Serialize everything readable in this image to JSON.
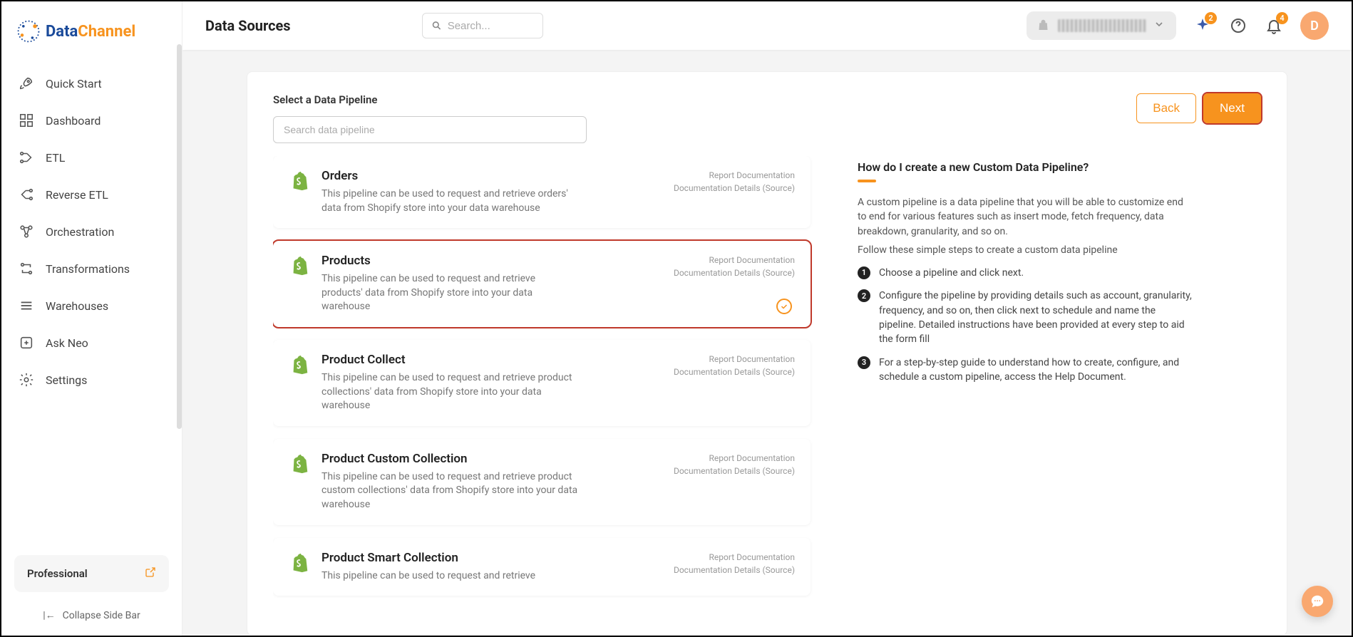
{
  "brand": {
    "name1": "Data",
    "name2": "Channel"
  },
  "sidebar": {
    "items": [
      {
        "label": "Quick Start",
        "icon": "rocket"
      },
      {
        "label": "Dashboard",
        "icon": "grid"
      },
      {
        "label": "ETL",
        "icon": "etl"
      },
      {
        "label": "Reverse ETL",
        "icon": "reverse-etl"
      },
      {
        "label": "Orchestration",
        "icon": "orchestration"
      },
      {
        "label": "Transformations",
        "icon": "transformations"
      },
      {
        "label": "Warehouses",
        "icon": "warehouses"
      },
      {
        "label": "Ask Neo",
        "icon": "plus-box"
      },
      {
        "label": "Settings",
        "icon": "gear"
      }
    ],
    "plan": "Professional",
    "collapse": "Collapse Side Bar"
  },
  "header": {
    "title": "Data Sources",
    "search_placeholder": "Search...",
    "badge_sparkle": "2",
    "badge_bell": "4",
    "avatar": "D"
  },
  "main": {
    "select_label": "Select a Data Pipeline",
    "pipeline_search_placeholder": "Search data pipeline",
    "back_label": "Back",
    "next_label": "Next",
    "pipelines": [
      {
        "title": "Orders",
        "desc": "This pipeline can be used to request and retrieve orders' data from Shopify store into your data warehouse",
        "selected": false
      },
      {
        "title": "Products",
        "desc": "This pipeline can be used to request and retrieve products' data from Shopify store into your data warehouse",
        "selected": true
      },
      {
        "title": "Product Collect",
        "desc": "This pipeline can be used to request and retrieve product collections' data from Shopify store into your data warehouse",
        "selected": false
      },
      {
        "title": "Product Custom Collection",
        "desc": "This pipeline can be used to request and retrieve product custom collections' data from Shopify store into your data warehouse",
        "selected": false
      },
      {
        "title": "Product Smart Collection",
        "desc": "This pipeline can be used to request and retrieve",
        "selected": false
      }
    ],
    "link_report": "Report Documentation",
    "link_details": "Documentation Details (Source)"
  },
  "help": {
    "title": "How do I create a new Custom Data Pipeline?",
    "intro1": "A custom pipeline is a data pipeline that you will be able to customize end to end for various features such as insert mode, fetch frequency, data breakdown, granularity, and so on.",
    "intro2": "Follow these simple steps to create a custom data pipeline",
    "steps": [
      "Choose a pipeline and click next.",
      "Configure the pipeline by providing details such as account, granularity, frequency, and so on, then click next to schedule and name the pipeline. Detailed instructions have been provided at every step to aid the form fill",
      "For a step-by-step guide to understand how to create, configure, and schedule a custom pipeline, access the Help Document."
    ]
  }
}
